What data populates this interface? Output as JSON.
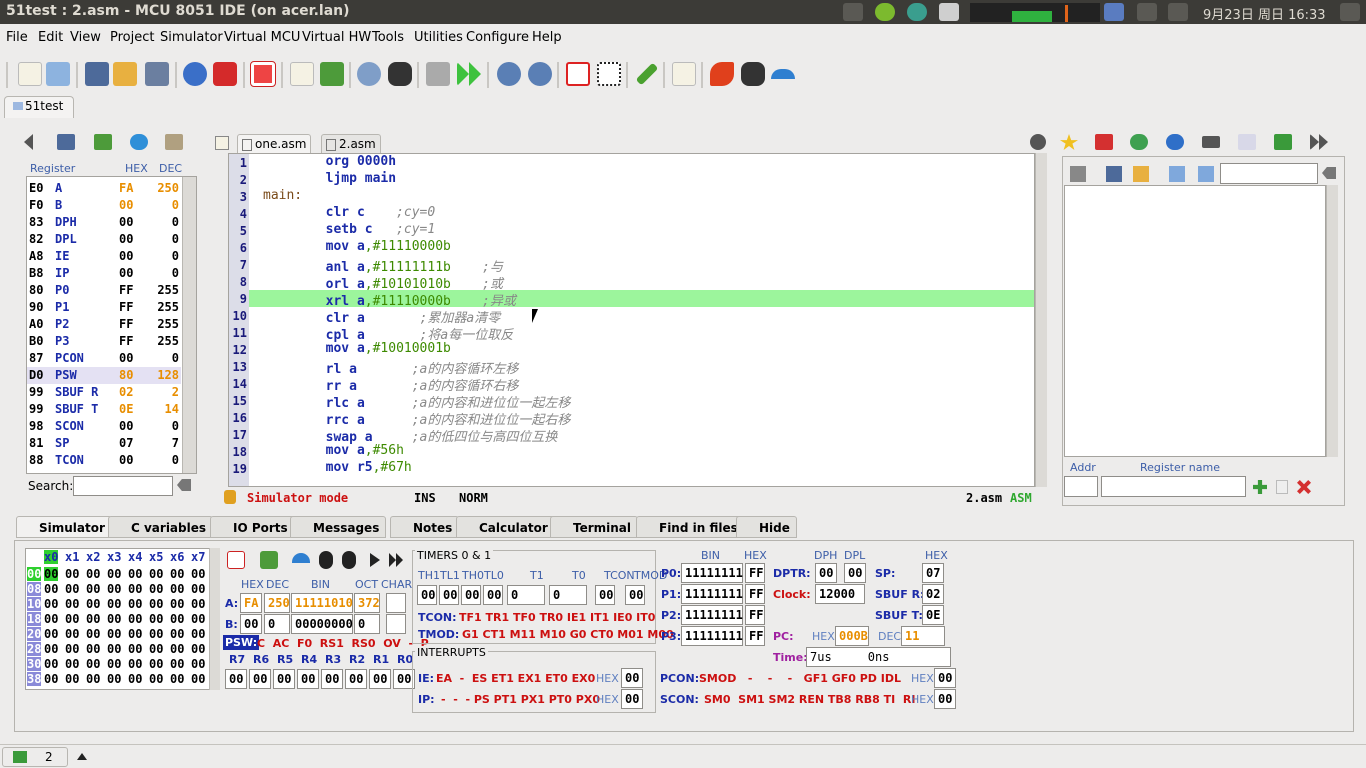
{
  "window": {
    "title": "51test : 2.asm - MCU 8051 IDE (on acer.lan)",
    "clock": "9月23日 周日 16:33"
  },
  "menu": [
    "File",
    "Edit",
    "View",
    "Project",
    "Simulator",
    "Virtual MCU",
    "Virtual HW",
    "Tools",
    "Utilities",
    "Configure",
    "Help"
  ],
  "project_tab": "51test",
  "editor_tabs": [
    "one.asm",
    "2.asm"
  ],
  "register_headers": {
    "register": "Register",
    "hex": "HEX",
    "dec": "DEC"
  },
  "registers": [
    {
      "addr": "E0",
      "name": "A",
      "hex": "FA",
      "dec": "250",
      "hi": true
    },
    {
      "addr": "F0",
      "name": "B",
      "hex": "00",
      "dec": "0",
      "hi": true
    },
    {
      "addr": "83",
      "name": "DPH",
      "hex": "00",
      "dec": "0"
    },
    {
      "addr": "82",
      "name": "DPL",
      "hex": "00",
      "dec": "0"
    },
    {
      "addr": "A8",
      "name": "IE",
      "hex": "00",
      "dec": "0"
    },
    {
      "addr": "B8",
      "name": "IP",
      "hex": "00",
      "dec": "0"
    },
    {
      "addr": "80",
      "name": "P0",
      "hex": "FF",
      "dec": "255"
    },
    {
      "addr": "90",
      "name": "P1",
      "hex": "FF",
      "dec": "255"
    },
    {
      "addr": "A0",
      "name": "P2",
      "hex": "FF",
      "dec": "255"
    },
    {
      "addr": "B0",
      "name": "P3",
      "hex": "FF",
      "dec": "255"
    },
    {
      "addr": "87",
      "name": "PCON",
      "hex": "00",
      "dec": "0"
    },
    {
      "addr": "D0",
      "name": "PSW",
      "hex": "80",
      "dec": "128",
      "hi": true
    },
    {
      "addr": "99",
      "name": "SBUF R",
      "hex": "02",
      "dec": "2",
      "hi": true
    },
    {
      "addr": "99",
      "name": "SBUF T",
      "hex": "0E",
      "dec": "14",
      "hi": true
    },
    {
      "addr": "98",
      "name": "SCON",
      "hex": "00",
      "dec": "0"
    },
    {
      "addr": "81",
      "name": "SP",
      "hex": "07",
      "dec": "7"
    },
    {
      "addr": "88",
      "name": "TCON",
      "hex": "00",
      "dec": "0"
    }
  ],
  "search_label": "Search:",
  "code_lines": [
    {
      "n": "1",
      "t": "        org 0000h"
    },
    {
      "n": "2",
      "t": "        ljmp main"
    },
    {
      "n": "3",
      "t": "main:"
    },
    {
      "n": "4",
      "t": "        clr c    ;cy=0"
    },
    {
      "n": "5",
      "t": "        setb c   ;cy=1"
    },
    {
      "n": "6",
      "t": "        mov a,#11110000b"
    },
    {
      "n": "7",
      "t": "        anl a,#11111111b    ;与"
    },
    {
      "n": "8",
      "t": "        orl a,#10101010b    ;或"
    },
    {
      "n": "9",
      "t": "        xrl a,#11110000b    ;异或"
    },
    {
      "n": "10",
      "t": "        clr a       ;累加器a清零"
    },
    {
      "n": "11",
      "t": "        cpl a       ;将a每一位取反"
    },
    {
      "n": "12",
      "t": "        mov a,#10010001b"
    },
    {
      "n": "13",
      "t": "        rl a       ;a的内容循环左移"
    },
    {
      "n": "14",
      "t": "        rr a       ;a的内容循环右移"
    },
    {
      "n": "15",
      "t": "        rlc a      ;a的内容和进位位一起左移"
    },
    {
      "n": "16",
      "t": "        rrc a      ;a的内容和进位位一起右移"
    },
    {
      "n": "17",
      "t": "        swap a     ;a的低四位与高四位互换"
    },
    {
      "n": "18",
      "t": "        mov a,#56h"
    },
    {
      "n": "19",
      "t": "        mov r5,#67h"
    }
  ],
  "status": {
    "mode": "Simulator mode",
    "ins": "INS",
    "norm": "NORM",
    "file": "2.asm",
    "lang": "ASM"
  },
  "right_panel": {
    "addr_label": "Addr",
    "regname_label": "Register name"
  },
  "bottom_tabs": [
    "Simulator",
    "C variables",
    "IO Ports",
    "Messages",
    "Notes",
    "Calculator",
    "Terminal",
    "Find in files",
    "Hide"
  ],
  "mem": {
    "cols": [
      "x0",
      "x1",
      "x2",
      "x3",
      "x4",
      "x5",
      "x6",
      "x7"
    ],
    "rows": [
      "00",
      "08",
      "10",
      "18",
      "20",
      "28",
      "30",
      "38"
    ]
  },
  "sim": {
    "hex_label": "HEX",
    "dec_label": "DEC",
    "bin_label": "BIN",
    "oct_label": "OCT",
    "char_label": "CHAR",
    "a_hex": "FA",
    "a_dec": "250",
    "a_bin": "11111010",
    "a_oct": "372",
    "b_hex": "00",
    "b_dec": "0",
    "b_bin": "00000000",
    "b_oct": "0",
    "psw_label": "PSW:",
    "psw_bits": "C  AC  F0  RS1  RS0  OV  -  P",
    "r_labels": [
      "R7",
      "R6",
      "R5",
      "R4",
      "R3",
      "R2",
      "R1",
      "R0"
    ],
    "r_values": [
      "00",
      "00",
      "00",
      "00",
      "00",
      "00",
      "00",
      "00"
    ],
    "timers_title": "TIMERS 0 & 1",
    "timer_heads": [
      "TH1",
      "TL1",
      "TH0",
      "TL0",
      "T1",
      "T0",
      "TCON",
      "TMOD"
    ],
    "timer_vals": [
      "00",
      "00",
      "00",
      "00",
      "0",
      "0",
      "00",
      "00"
    ],
    "tcon_label": "TCON:",
    "tcon_bits": "TF1 TR1 TF0 TR0 IE1 IT1 IE0 IT0",
    "tmod_label": "TMOD:",
    "tmod_bits": "G1 CT1 M11 M10 G0 CT0 M01 M00",
    "interrupts_title": "INTERRUPTS",
    "ie_label": "IE:",
    "ie_bits": "EA  -  ES ET1 EX1 ET0 EX0",
    "ie_hex": "00",
    "ip_label": "IP:",
    "ip_bits": "-  -  - PS PT1 PX1 PT0 PX0",
    "ip_hex": "00",
    "ports": [
      {
        "n": "P0:",
        "bin": "11111111",
        "hex": "FF"
      },
      {
        "n": "P1:",
        "bin": "11111111",
        "hex": "FF"
      },
      {
        "n": "P2:",
        "bin": "11111111",
        "hex": "FF"
      },
      {
        "n": "P3:",
        "bin": "11111111",
        "hex": "FF"
      }
    ],
    "dptr_label": "DPTR:",
    "dph_label": "DPH",
    "dpl_label": "DPL",
    "dph": "00",
    "dpl": "00",
    "clock_label": "Clock:",
    "clock": "12000",
    "pc_label": "PC:",
    "pc_hex": "000B",
    "pc_dec": "11",
    "time_label": "Time:",
    "time": "7us     0ns",
    "sp_label": "SP:",
    "sp": "07",
    "sbufr_label": "SBUF R:",
    "sbufr": "02",
    "sbuft_label": "SBUF T:",
    "sbuft": "0E",
    "pcon_label": "PCON:",
    "pcon_bits": "SMOD   -    -    -   GF1 GF0 PD IDL",
    "pcon_hex": "00",
    "scon_label": "SCON:",
    "scon_bits": "SM0  SM1 SM2 REN TB8 RB8 TI  RI",
    "scon_hex": "00"
  },
  "statusbar": {
    "count": "2"
  }
}
